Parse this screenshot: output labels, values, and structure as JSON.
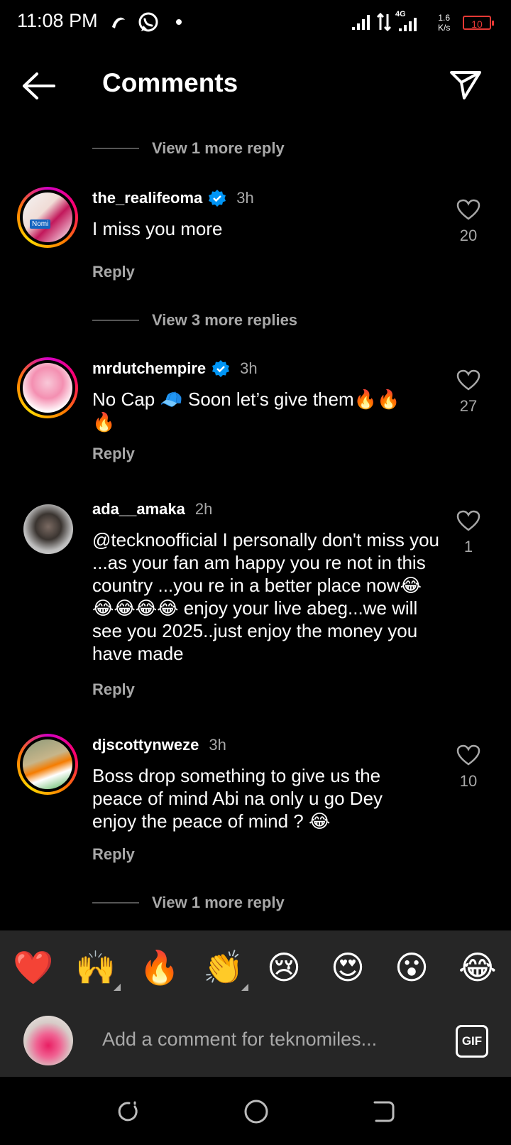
{
  "status_bar": {
    "time": "11:08 PM",
    "network_speed_value": "1.6",
    "network_speed_unit": "K/s",
    "battery": "10",
    "network_type": "4G"
  },
  "header": {
    "title": "Comments"
  },
  "view_more_top": "View 1 more reply",
  "comments": [
    {
      "username": "the_realifeoma",
      "verified": true,
      "time": "3h",
      "text": "I miss you more",
      "likes": "20",
      "reply_label": "Reply",
      "avatar_caption": "Nomi"
    },
    {
      "view_more": "View 3 more replies"
    },
    {
      "username": "mrdutchempire",
      "verified": true,
      "time": "3h",
      "text_line1": "No Cap 🧢 Soon let’s give them🔥🔥",
      "text_line2": "🔥",
      "likes": "27",
      "reply_label": "Reply"
    },
    {
      "username": "ada__amaka",
      "verified": false,
      "time": "2h",
      "text": "@tecknoofficial I personally don't miss you ...as your fan  am happy you re not in this country ...you re in a better place now😂😂😂😂😂 enjoy your live abeg...we will see you 2025..just enjoy the money you have made",
      "likes": "1",
      "reply_label": "Reply"
    },
    {
      "username": "djscottynweze",
      "verified": false,
      "time": "3h",
      "text": "Boss drop something to give us the peace of mind Abi na only u go Dey enjoy the peace of mind ? 😂",
      "likes": "10",
      "reply_label": "Reply"
    }
  ],
  "view_more_bottom": "View 1 more reply",
  "emoji_bar": [
    "❤️",
    "🙌",
    "🔥",
    "👏",
    "😢",
    "😍",
    "😮",
    "😂"
  ],
  "comment_input": {
    "placeholder": "Add a comment for teknomiles...",
    "gif_label": "GIF"
  },
  "colors": {
    "background": "#000000",
    "secondary_text": "#a8a8a8",
    "verified": "#0095f6",
    "battery_low": "#e53935",
    "bar_bg": "#262626"
  }
}
